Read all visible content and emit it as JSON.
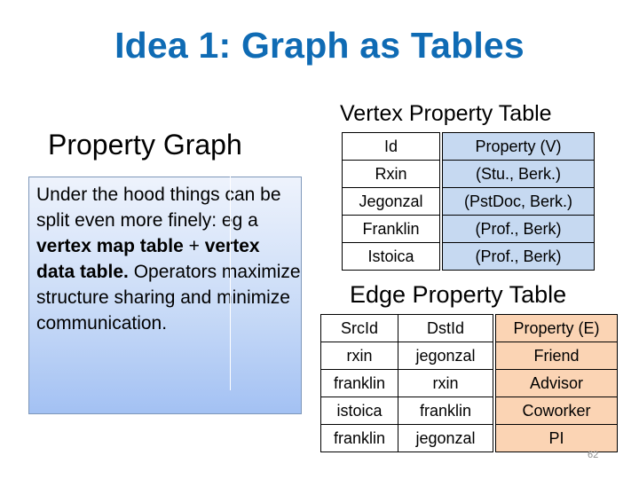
{
  "slide": {
    "title": "Idea 1: Graph as Tables",
    "page_number": "62"
  },
  "left_panel": {
    "heading": "Property Graph",
    "body": {
      "line1": "Under the hood things can be split even more finely: eg a ",
      "bold1": "vertex map table",
      "mid": " + ",
      "bold2": "vertex data table.",
      "line2": " Operators maximize structure sharing and minimize communication."
    }
  },
  "vertex_table": {
    "title": "Vertex Property Table",
    "headers": [
      "Id",
      "Property (V)"
    ],
    "rows": [
      [
        "Rxin",
        "(Stu., Berk.)"
      ],
      [
        "Jegonzal",
        "(PstDoc, Berk.)"
      ],
      [
        "Franklin",
        "(Prof., Berk)"
      ],
      [
        "Istoica",
        "(Prof., Berk)"
      ]
    ]
  },
  "edge_table": {
    "title": "Edge Property Table",
    "headers": [
      "SrcId",
      "DstId",
      "Property (E)"
    ],
    "rows": [
      [
        "rxin",
        "jegonzal",
        "Friend"
      ],
      [
        "franklin",
        "rxin",
        "Advisor"
      ],
      [
        "istoica",
        "franklin",
        "Coworker"
      ],
      [
        "franklin",
        "jegonzal",
        "PI"
      ]
    ]
  },
  "colors": {
    "title": "#0f6bb4",
    "vertex_property_fill": "#c6d9f1",
    "edge_property_fill": "#fbd4b4",
    "box_gradient_top": "#eef3fc",
    "box_gradient_bottom": "#a3c1f3"
  }
}
